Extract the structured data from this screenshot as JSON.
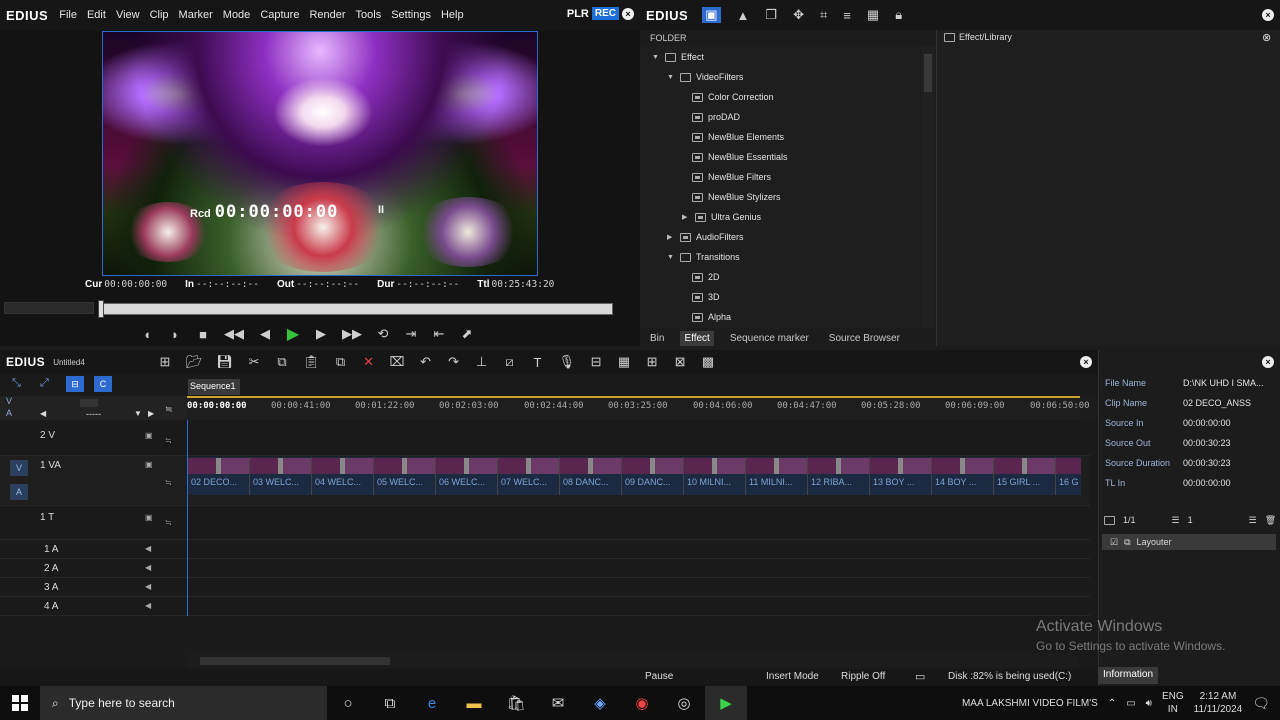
{
  "app": {
    "logo": "EDIUS"
  },
  "menu": [
    "File",
    "Edit",
    "View",
    "Clip",
    "Marker",
    "Mode",
    "Capture",
    "Render",
    "Tools",
    "Settings",
    "Help"
  ],
  "player": {
    "plr": "PLR",
    "rec": "REC",
    "rcd_label": "Rcd",
    "rcd_tc": "00:00:00:00",
    "pause_symbol": "II",
    "timecodes": [
      {
        "label": "Cur",
        "value": "00:00:00:00"
      },
      {
        "label": "In",
        "value": "--:--:--:--"
      },
      {
        "label": "Out",
        "value": "--:--:--:--"
      },
      {
        "label": "Dur",
        "value": "--:--:--:--"
      },
      {
        "label": "Ttl",
        "value": "00:25:43:20"
      }
    ]
  },
  "library": {
    "folder_header": "FOLDER",
    "panel_title": "Effect/Library",
    "tree": [
      "Effect",
      "VideoFilters",
      "Color Correction",
      "proDAD",
      "NewBlue Elements",
      "NewBlue Essentials",
      "NewBlue Filters",
      "NewBlue Stylizers",
      "Ultra Genius",
      "AudioFilters",
      "Transitions",
      "2D",
      "3D",
      "Alpha"
    ],
    "tabs": [
      "Bin",
      "Effect",
      "Sequence marker",
      "Source Browser"
    ]
  },
  "timeline": {
    "logo": "EDIUS",
    "project": "Untitled4",
    "sequence_tab": "Sequence1",
    "ruler_start": "00:00:00:00",
    "ruler": [
      "00:00:41:00",
      "00:01:22:00",
      "00:02:03:00",
      "00:02:44:00",
      "00:03:25:00",
      "00:04:06:00",
      "00:04:47:00",
      "00:05:28:00",
      "00:06:09:00",
      "00:06:50:00"
    ],
    "tracks": {
      "v2": "2 V",
      "va1": "1 VA",
      "t1": "1 T",
      "a1": "1 A",
      "a2": "2 A",
      "a3": "3 A",
      "a4": "4 A"
    },
    "hdr_dash": "-----",
    "clips": [
      "02 DECO...",
      "03 WELC...",
      "04 WELC...",
      "05 WELC...",
      "06 WELC...",
      "07 WELC...",
      "08 DANC...",
      "09 DANC...",
      "10 MILNI...",
      "11 MILNI...",
      "12 RIBA...",
      "13 BOY ...",
      "14 BOY ...",
      "15 GIRL ...",
      "16 G"
    ]
  },
  "status": {
    "pause": "Pause",
    "insert": "Insert Mode",
    "ripple": "Ripple Off",
    "disk": "Disk :82% is being used(C:)"
  },
  "info": {
    "rows": [
      {
        "k": "File Name",
        "v": "D:\\NK UHD I SMA..."
      },
      {
        "k": "Clip Name",
        "v": "02 DECO_ANSS"
      },
      {
        "k": "Source In",
        "v": "00:00:00:00"
      },
      {
        "k": "Source Out",
        "v": "00:00:30:23"
      },
      {
        "k": "Source Duration",
        "v": "00:00:30:23"
      },
      {
        "k": "TL In",
        "v": "00:00:00:00"
      }
    ],
    "layer_count": "1/1",
    "layer_num": "1",
    "layer_name": "Layouter",
    "tab": "Information"
  },
  "watermark": {
    "title": "Activate Windows",
    "sub": "Go to Settings to activate Windows."
  },
  "taskbar": {
    "search_placeholder": "Type here to search",
    "tray_text": "MAA LAKSHMI VIDEO FILM'S",
    "lang1": "ENG",
    "lang2": "IN",
    "time": "2:12 AM",
    "date": "11/11/2024"
  },
  "colors": {
    "accent": "#2d6bd1",
    "play": "#36c23c",
    "ruler_line": "#d0a12e",
    "clip_text": "#7fa3d8"
  }
}
